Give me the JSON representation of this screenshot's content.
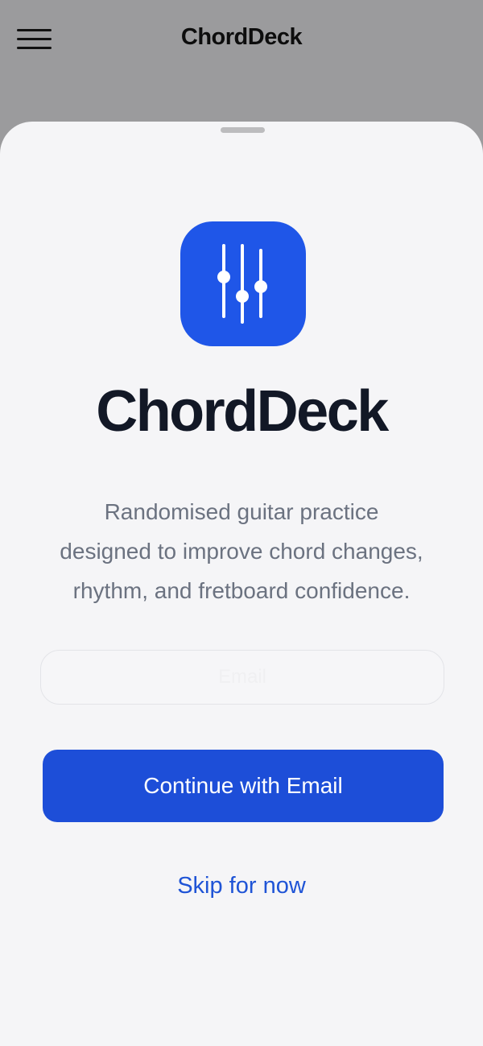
{
  "header": {
    "title": "ChordDeck",
    "menu_icon": "hamburger-menu-icon"
  },
  "sheet": {
    "app_icon": "equalizer-sliders-icon",
    "brand_name": "ChordDeck",
    "tagline_lines": [
      "Randomised guitar practice",
      "designed to improve chord changes,",
      "rhythm, and fretboard confidence."
    ],
    "email_input": {
      "value": "",
      "placeholder": "Email"
    },
    "continue_label": "Continue with Email",
    "skip_label": "Skip for now"
  },
  "colors": {
    "accent": "#1d4ed8",
    "icon_bg": "#1f56e8",
    "backdrop": "#9b9b9d",
    "sheet_bg": "#f5f5f7",
    "brand_text": "#121826",
    "muted_text": "#6b7280",
    "link": "#1f54d6"
  }
}
